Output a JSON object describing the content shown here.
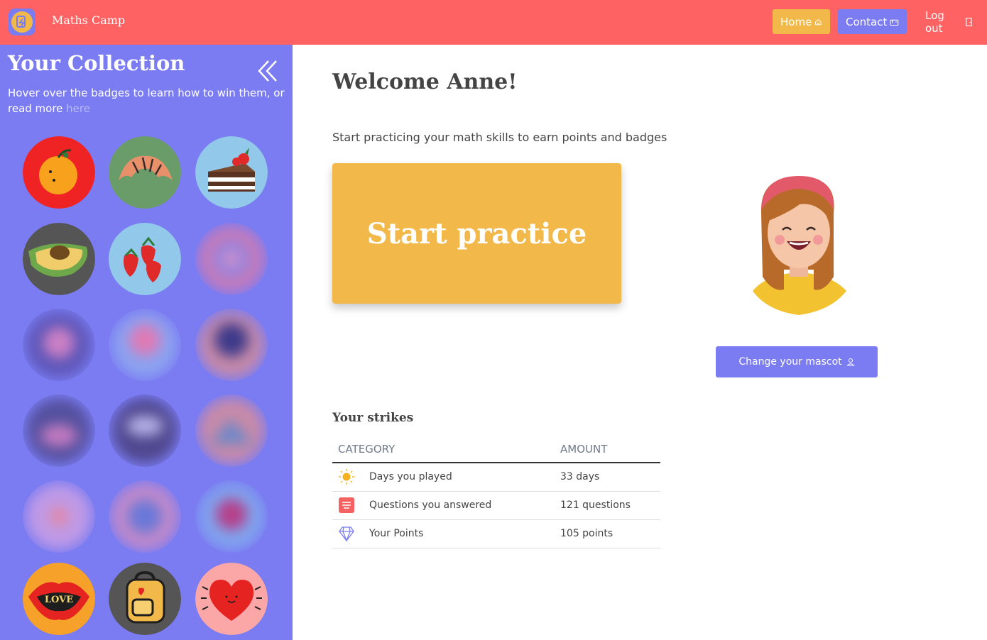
{
  "header": {
    "app_title": "Maths Camp",
    "nav": {
      "home": "Home",
      "contact": "Contact",
      "logout": "Log out"
    },
    "colors": {
      "background": "#fe6262",
      "home": "#f2b94a",
      "contact": "#7b7cf2"
    }
  },
  "sidebar": {
    "title": "Your Collection",
    "help_text": "Hover over the badges to learn how to win them, or read more ",
    "help_link": "here",
    "background": "#7b7cf2",
    "badges": [
      {
        "name": "orange",
        "locked": false
      },
      {
        "name": "croissant",
        "locked": false
      },
      {
        "name": "cake",
        "locked": false
      },
      {
        "name": "avocado",
        "locked": false
      },
      {
        "name": "strawberries",
        "locked": false
      },
      {
        "name": "locked-1",
        "locked": true
      },
      {
        "name": "locked-2",
        "locked": true
      },
      {
        "name": "locked-3",
        "locked": true
      },
      {
        "name": "locked-4",
        "locked": true
      },
      {
        "name": "locked-5",
        "locked": true
      },
      {
        "name": "locked-6",
        "locked": true
      },
      {
        "name": "locked-7",
        "locked": true
      },
      {
        "name": "locked-8",
        "locked": true
      },
      {
        "name": "locked-9",
        "locked": true
      },
      {
        "name": "locked-10",
        "locked": true
      },
      {
        "name": "lips",
        "locked": false,
        "text": "LOVE"
      },
      {
        "name": "backpack",
        "locked": false
      },
      {
        "name": "heart",
        "locked": false
      }
    ]
  },
  "main": {
    "welcome": "Welcome Anne!",
    "intro": "Start practicing your math skills to earn points and badges",
    "start_button": "Start practice",
    "mascot_button": "Change your mascot",
    "strikes": {
      "title": "Your strikes",
      "columns": [
        "CATEGORY",
        "AMOUNT"
      ],
      "rows": [
        {
          "icon": "sun-icon",
          "category": "Days you played",
          "amount": "33 days"
        },
        {
          "icon": "questions-icon",
          "category": "Questions you answered",
          "amount": "121 questions"
        },
        {
          "icon": "diamond-icon",
          "category": "Your Points",
          "amount": "105 points"
        }
      ]
    }
  }
}
